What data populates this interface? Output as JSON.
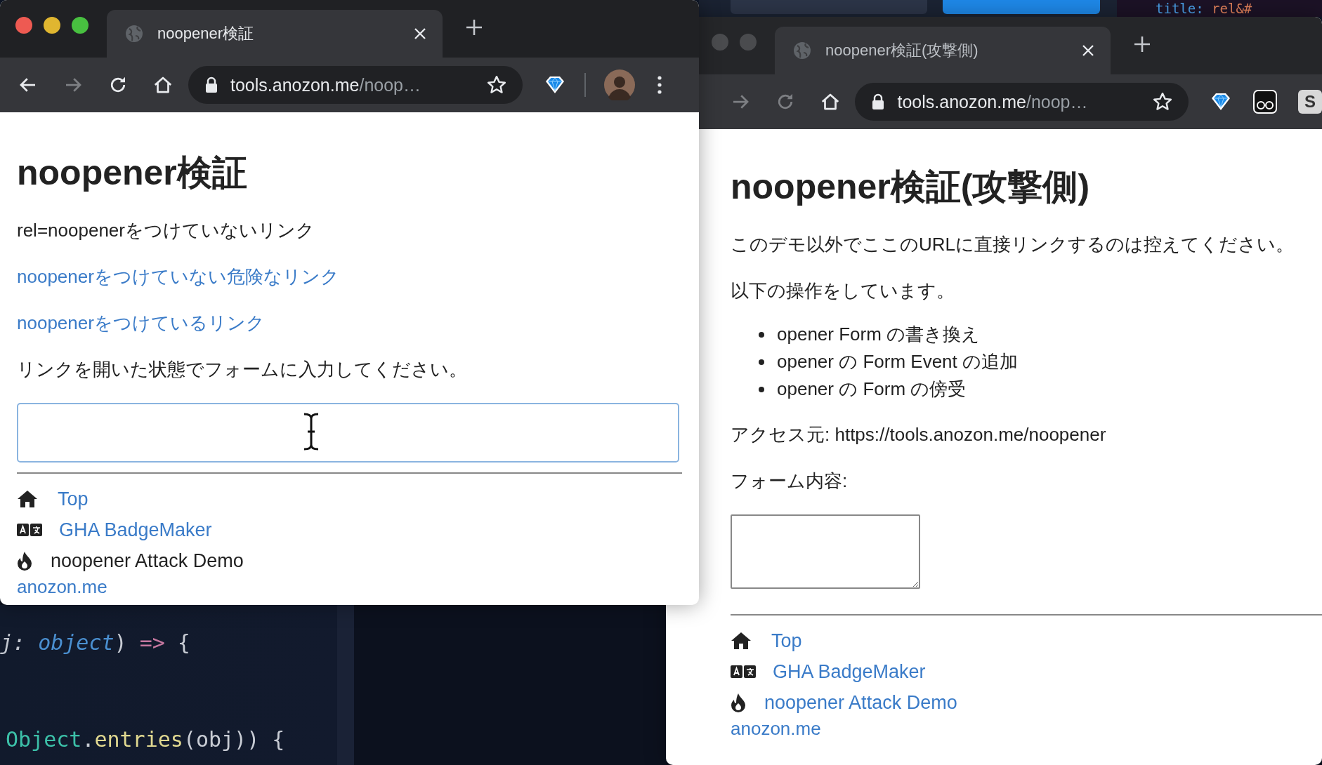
{
  "editor": {
    "lines": [
      {
        "tokens": [
          {
            "text": "j: ",
            "kind": "param"
          },
          {
            "text": "object",
            "kind": "type"
          },
          {
            "text": ") ",
            "kind": "punct"
          },
          {
            "text": "=>",
            "kind": "operator"
          },
          {
            "text": " {",
            "kind": "punct"
          }
        ]
      },
      {
        "tokens": [
          {
            "text": "Object",
            "kind": "class"
          },
          {
            "text": ".",
            "kind": "punct"
          },
          {
            "text": "entries",
            "kind": "method"
          },
          {
            "text": "(obj)) {",
            "kind": "punct"
          }
        ]
      }
    ]
  },
  "top_strip": {
    "code": [
      {
        "text": "title: ",
        "kind": "property"
      },
      {
        "text": "rel&#",
        "kind": "string"
      }
    ]
  },
  "windows": [
    {
      "focused": true,
      "traffic_lights": [
        {
          "kind": "close"
        },
        {
          "kind": "minimize"
        },
        {
          "kind": "zoom"
        }
      ],
      "tab": {
        "title": "noopener検証"
      },
      "nav_buttons": [
        {
          "kind": "back",
          "disabled": false
        },
        {
          "kind": "forward",
          "disabled": true
        },
        {
          "kind": "reload",
          "disabled": false
        },
        {
          "kind": "home",
          "disabled": false
        }
      ],
      "address": {
        "host": "tools.anozon.me",
        "path": "/noop…"
      },
      "extensions": [
        {
          "kind": "diamond"
        },
        {
          "kind": "divider"
        },
        {
          "kind": "avatar"
        },
        {
          "kind": "menu"
        }
      ],
      "content": [
        {
          "kind": "heading",
          "text": "noopener検証"
        },
        {
          "kind": "paragraph",
          "text": "rel=noopenerをつけていないリンク"
        },
        {
          "kind": "link",
          "text": "noopenerをつけていない危険なリンク"
        },
        {
          "kind": "link",
          "text": "noopenerをつけているリンク"
        },
        {
          "kind": "paragraph",
          "text": "リンクを開いた状態でフォームに入力してください。"
        },
        {
          "kind": "input"
        },
        {
          "kind": "rule"
        }
      ],
      "footer": {
        "links": [
          {
            "kind": "home",
            "label": "Top",
            "current": false
          },
          {
            "kind": "translate",
            "label": "GHA BadgeMaker",
            "current": false
          },
          {
            "kind": "fire",
            "label": "noopener Attack Demo",
            "current": true
          }
        ],
        "site": "anozon.me"
      }
    },
    {
      "focused": false,
      "traffic_lights": [
        {
          "kind": "minimize"
        },
        {
          "kind": "zoom"
        }
      ],
      "tab": {
        "title": "noopener検証(攻撃側)"
      },
      "nav_buttons": [
        {
          "kind": "forward",
          "disabled": true
        },
        {
          "kind": "reload",
          "disabled": true
        },
        {
          "kind": "home",
          "disabled": false
        }
      ],
      "address": {
        "host": "tools.anozon.me",
        "path": "/noop…"
      },
      "extensions": [
        {
          "kind": "diamond"
        },
        {
          "kind": "mask"
        },
        {
          "kind": "letter",
          "label": "S"
        }
      ],
      "content": [
        {
          "kind": "heading",
          "text": "noopener検証(攻撃側)"
        },
        {
          "kind": "paragraph",
          "text": "このデモ以外でここのURLに直接リンクするのは控えてください。"
        },
        {
          "kind": "paragraph",
          "text": "以下の操作をしています。"
        },
        {
          "kind": "list",
          "items": [
            "opener Form の書き換え",
            "opener の Form Event の追加",
            "opener の Form の傍受"
          ]
        },
        {
          "kind": "paragraph",
          "text": "アクセス元: https://tools.anozon.me/noopener"
        },
        {
          "kind": "paragraph",
          "text": "フォーム内容:"
        },
        {
          "kind": "textarea"
        },
        {
          "kind": "rule"
        }
      ],
      "footer": {
        "links": [
          {
            "kind": "home",
            "label": "Top",
            "current": false
          },
          {
            "kind": "translate",
            "label": "GHA BadgeMaker",
            "current": false
          },
          {
            "kind": "fire",
            "label": "noopener Attack Demo",
            "current": false
          }
        ],
        "site": "anozon.me"
      }
    }
  ]
}
